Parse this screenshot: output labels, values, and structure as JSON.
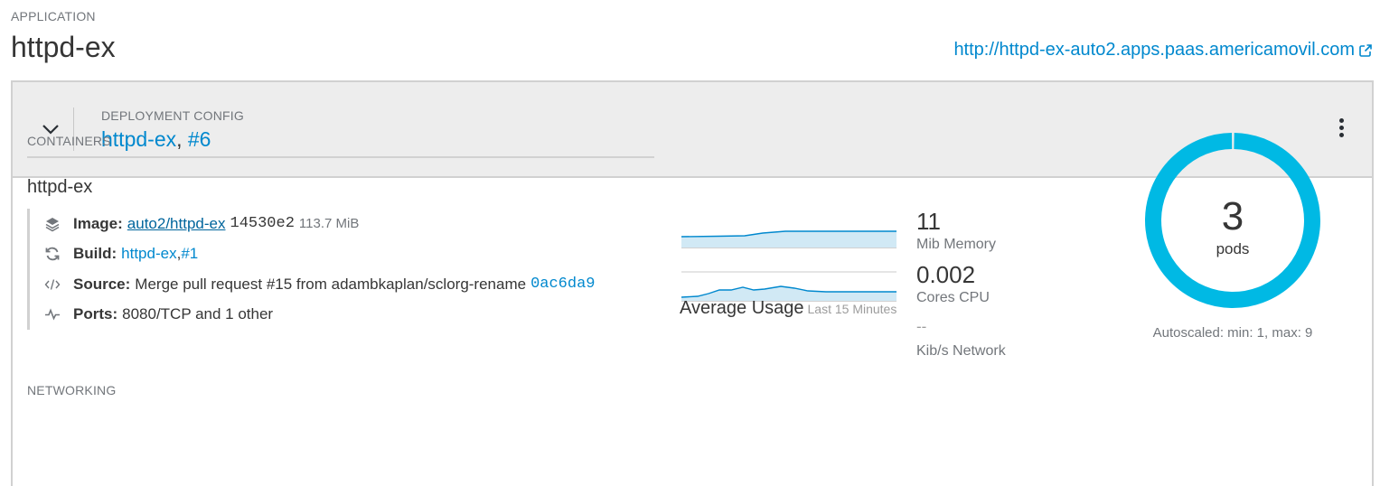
{
  "header": {
    "section_label": "APPLICATION",
    "app_name": "httpd-ex",
    "route_url": "http://httpd-ex-auto2.apps.paas.americamovil.com"
  },
  "deployment": {
    "label": "DEPLOYMENT CONFIG",
    "name": "httpd-ex",
    "separator": ", ",
    "version": "#6"
  },
  "containers": {
    "label": "CONTAINERS",
    "name": "httpd-ex",
    "image": {
      "label": "Image:",
      "repo": "auto2/httpd-ex",
      "digest": "14530e2",
      "size": "113.7 MiB"
    },
    "build": {
      "label": "Build:",
      "name": "httpd-ex",
      "separator": ", ",
      "number": "#1"
    },
    "source": {
      "label": "Source:",
      "message": "Merge pull request #15 from adambkaplan/sclorg-rename",
      "commit": "0ac6da9"
    },
    "ports": {
      "label": "Ports:",
      "value": "8080/TCP and 1 other"
    }
  },
  "metrics": {
    "memory": {
      "value": "11",
      "unit": "Mib Memory"
    },
    "cpu": {
      "value": "0.002",
      "unit": "Cores CPU"
    },
    "network": {
      "value": "--",
      "unit": "Kib/s Network"
    },
    "average_label": "Average Usage",
    "average_range": "Last 15 Minutes"
  },
  "pods": {
    "count": "3",
    "label": "pods",
    "autoscaled": "Autoscaled: min: 1, max: 9",
    "ring_color": "#00b9e4"
  },
  "networking": {
    "label": "NETWORKING"
  },
  "colors": {
    "link": "#0088ce",
    "spark_line": "#0088ce",
    "spark_fill": "#d1e9f5"
  }
}
